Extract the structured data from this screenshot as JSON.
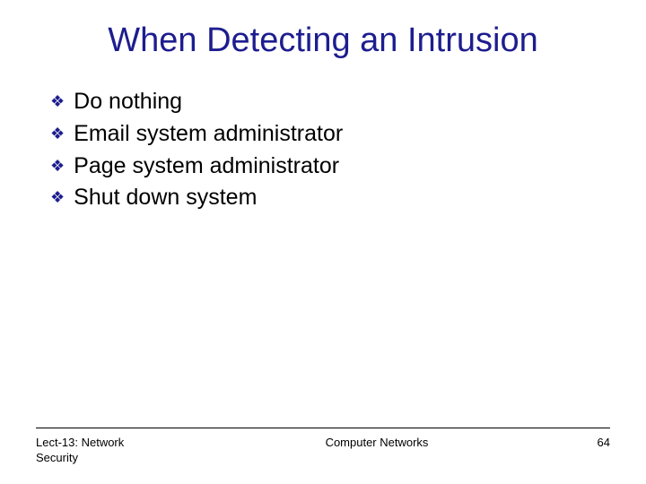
{
  "title": "When Detecting an Intrusion",
  "bullets": [
    "Do nothing",
    "Email system administrator",
    "Page system administrator",
    "Shut down system"
  ],
  "footer": {
    "left_line1": "Lect-13: Network",
    "left_line2": "Security",
    "center": "Computer Networks",
    "page": "64"
  }
}
